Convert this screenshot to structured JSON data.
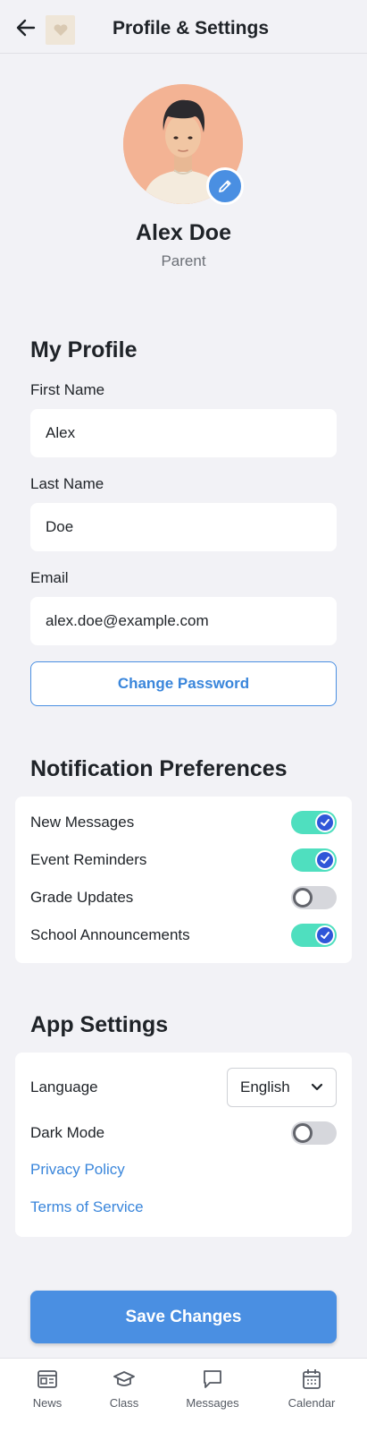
{
  "header": {
    "title": "Profile & Settings",
    "back_icon": "arrow-left-icon"
  },
  "profile": {
    "name": "Alex Doe",
    "role": "Parent",
    "edit_icon": "pencil-icon"
  },
  "my_profile": {
    "title": "My Profile",
    "first_name_label": "First Name",
    "first_name_value": "Alex",
    "last_name_label": "Last Name",
    "last_name_value": "Doe",
    "email_label": "Email",
    "email_value": "alex.doe@example.com",
    "change_password_label": "Change Password"
  },
  "notifications": {
    "title": "Notification Preferences",
    "items": [
      {
        "label": "New Messages",
        "enabled": true
      },
      {
        "label": "Event Reminders",
        "enabled": true
      },
      {
        "label": "Grade Updates",
        "enabled": false
      },
      {
        "label": "School Announcements",
        "enabled": true
      }
    ]
  },
  "app_settings": {
    "title": "App Settings",
    "language_label": "Language",
    "language_value": "English",
    "dark_mode_label": "Dark Mode",
    "dark_mode_enabled": false,
    "privacy_policy": "Privacy Policy",
    "terms_of_service": "Terms of Service"
  },
  "actions": {
    "save_label": "Save Changes"
  },
  "bottom_nav": {
    "items": [
      {
        "label": "News",
        "icon": "newspaper-icon"
      },
      {
        "label": "Class",
        "icon": "graduation-cap-icon"
      },
      {
        "label": "Messages",
        "icon": "chat-bubble-icon"
      },
      {
        "label": "Calendar",
        "icon": "calendar-icon"
      }
    ]
  },
  "colors": {
    "accent": "#4a8fe2",
    "toggle_on": "#4fdfbf",
    "toggle_off": "#d6d7dc",
    "background": "#f2f2f6",
    "link": "#3a86db"
  }
}
